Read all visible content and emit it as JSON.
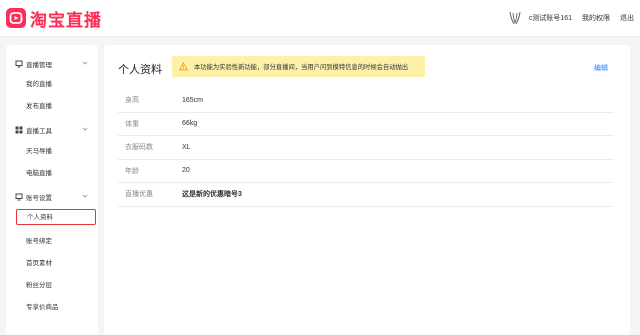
{
  "header": {
    "logo_text": "淘宝直播",
    "account": "c测试账号161",
    "permissions": "我的权限",
    "logout": "退出"
  },
  "sidebar": {
    "groups": [
      {
        "title": "直播管理",
        "icon": "monitor-icon",
        "items": [
          "我的直播",
          "发布直播"
        ]
      },
      {
        "title": "直播工具",
        "icon": "grid-icon",
        "items": [
          "天马导播",
          "电脑直播"
        ]
      },
      {
        "title": "账号设置",
        "icon": "monitor-icon",
        "items": [
          "个人资料",
          "账号绑定",
          "首页素材",
          "粉丝分层",
          "专享价商品"
        ]
      }
    ],
    "active_item": "个人资料"
  },
  "main": {
    "title": "个人资料",
    "notice": "本功能为实验性新功能，部分直播间，当用户问到模特信息的时候会自动抛出",
    "edit": "编辑",
    "rows": [
      {
        "label": "身高",
        "value": "165cm"
      },
      {
        "label": "体重",
        "value": "66kg"
      },
      {
        "label": "衣服码数",
        "value": "XL"
      },
      {
        "label": "年龄",
        "value": "20"
      },
      {
        "label": "直播优惠",
        "value": "这是新的优惠暗号3"
      }
    ]
  },
  "colors": {
    "brand": "#ff2c55",
    "link": "#2b7de9",
    "notice_bg": "#fdf1a8",
    "active_border": "#e63535"
  }
}
